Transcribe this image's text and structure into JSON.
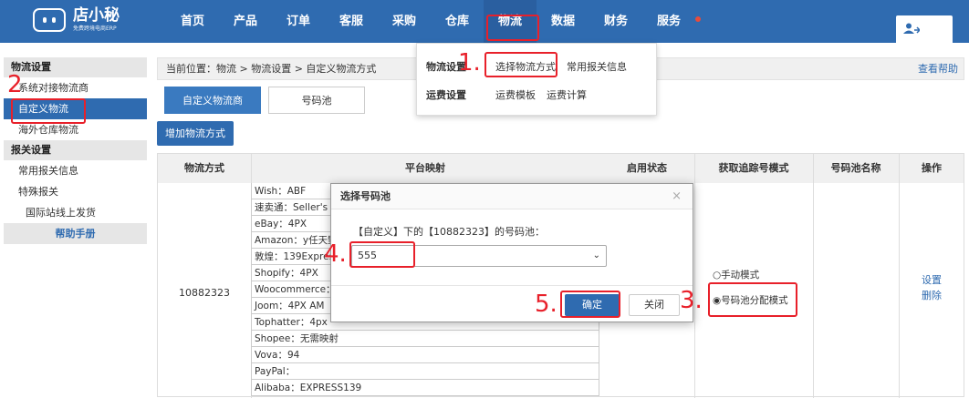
{
  "logo": {
    "name": "店小秘",
    "sub": "免费跨境电商ERP"
  },
  "nav": {
    "items": [
      "首页",
      "产品",
      "订单",
      "客服",
      "采购",
      "仓库",
      "物流",
      "数据",
      "财务",
      "服务"
    ]
  },
  "sidebar": {
    "group1": "物流设置",
    "items1": [
      "系统对接物流商",
      "自定义物流",
      "海外仓库物流"
    ],
    "group2": "报关设置",
    "items2": [
      "常用报关信息",
      "特殊报关"
    ],
    "sub_item": "国际站线上发货",
    "help": "帮助手册"
  },
  "breadcrumb": {
    "text": "当前位置：物流 > 物流设置 > 自定义物流方式",
    "help": "查看帮助"
  },
  "tabs": [
    "自定义物流商",
    "号码池"
  ],
  "add_button": "增加物流方式",
  "table": {
    "headers": [
      "物流方式",
      "平台映射",
      "启用状态",
      "获取追踪号模式",
      "号码池名称",
      "操作"
    ],
    "id": "10882323",
    "mappings": [
      "Wish：ABF",
      "速卖通：Seller's S",
      "eBay：4PX",
      "Amazon：y任天野",
      "敦煌：139Express",
      "Shopify：4PX",
      "Woocommerce：",
      "Joom：4PX AM",
      "Tophatter：4px",
      "Shopee：无需映射",
      "Vova：94",
      "PayPal：",
      "Alibaba：EXPRESS139"
    ],
    "modes": [
      "○手动模式",
      "◉号码池分配模式"
    ],
    "ops": [
      "设置",
      "删除"
    ]
  },
  "dropdown": {
    "row1_head": "物流设置",
    "row1_links": [
      "选择物流方式",
      "常用报关信息"
    ],
    "row2_head": "运费设置",
    "row2_links": [
      "运费模板",
      "运费计算"
    ]
  },
  "modal": {
    "title": "选择号码池",
    "close": "×",
    "desc": "【自定义】下的【10882323】的号码池：",
    "select_value": "555",
    "ok": "确定",
    "cancel": "关闭"
  },
  "annotations": [
    "1.",
    "2",
    "3.",
    "4.",
    "5."
  ],
  "colors": {
    "primary": "#2f6bb0",
    "highlight": "#e8202a"
  }
}
